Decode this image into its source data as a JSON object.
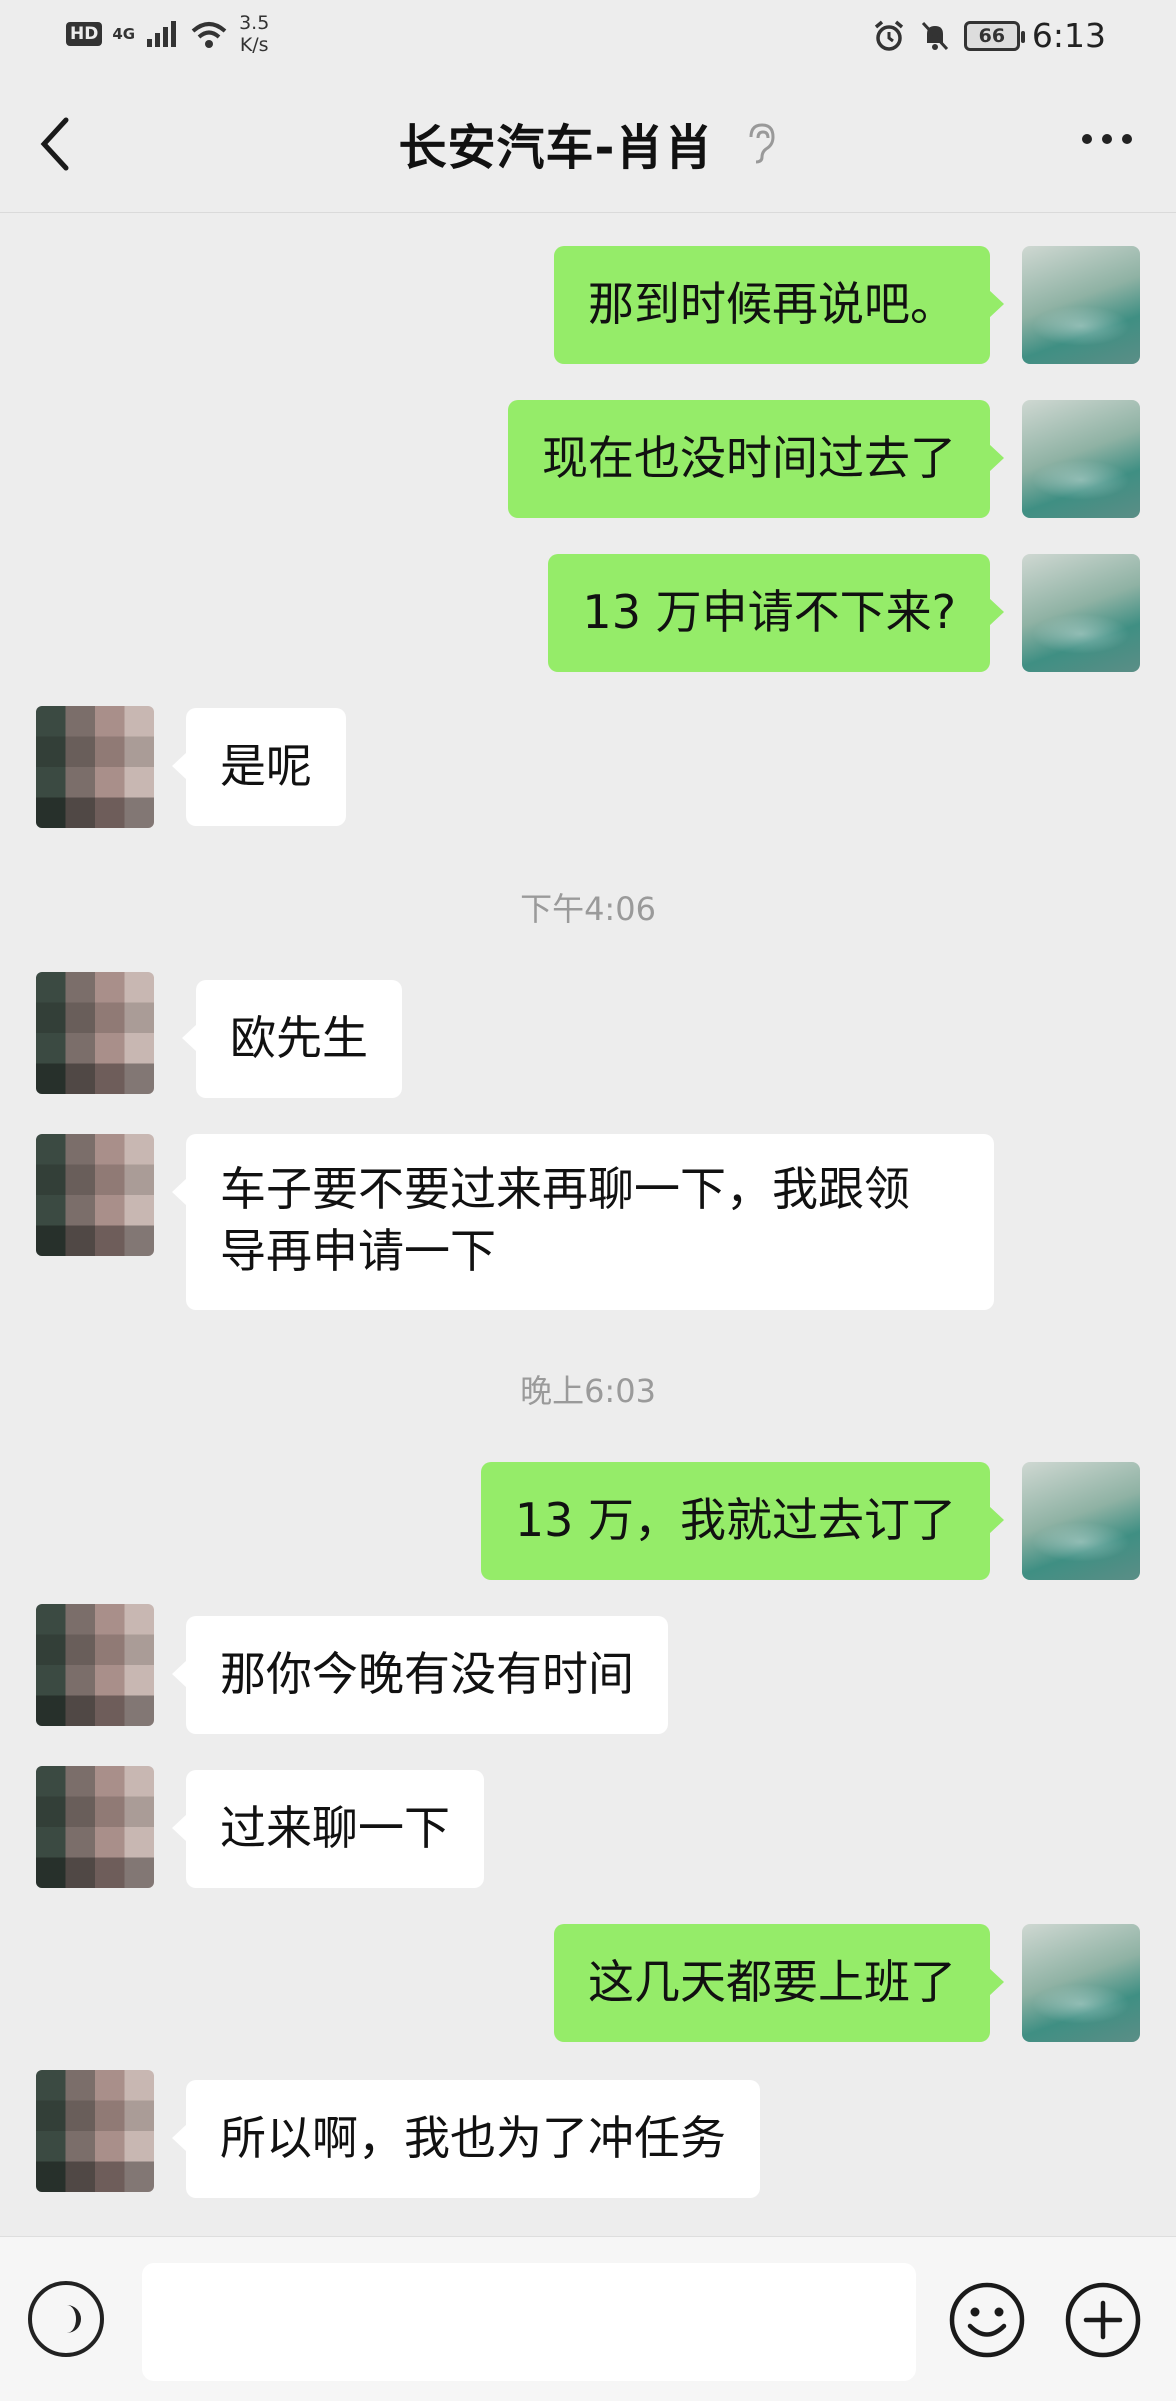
{
  "status_bar": {
    "hd": "HD",
    "network": "4G",
    "speed_value": "3.5",
    "speed_unit": "K/s",
    "battery": "66",
    "time": "6:13"
  },
  "header": {
    "title": "长安汽车-肖肖",
    "icons": [
      "back-arrow-icon",
      "ear-icon",
      "more-dots-icon"
    ]
  },
  "messages": [
    {
      "from": "me",
      "text": "那到时候再说吧。"
    },
    {
      "from": "me",
      "text": "现在也没时间过去了"
    },
    {
      "from": "me",
      "text": "13 万申请不下来?"
    },
    {
      "from": "other",
      "text": "是呢"
    },
    {
      "type": "time",
      "text": "下午4:06"
    },
    {
      "from": "other",
      "text": "欧先生"
    },
    {
      "from": "other",
      "line1": "车子要不要过来再聊一下，我跟领",
      "line2": "导再申请一下"
    },
    {
      "type": "time",
      "text": "晚上6:03"
    },
    {
      "from": "me",
      "text": "13 万，我就过去订了"
    },
    {
      "from": "other",
      "text": "那你今晚有没有时间"
    },
    {
      "from": "other",
      "text": "过来聊一下"
    },
    {
      "from": "me",
      "text": "这几天都要上班了"
    },
    {
      "from": "other",
      "text": "所以啊，我也为了冲任务"
    }
  ],
  "input_bar": {
    "value": "",
    "icons": [
      "voice-icon",
      "emoji-icon",
      "plus-icon"
    ]
  },
  "colors": {
    "background": "#ededed",
    "my_bubble": "#95ec69",
    "other_bubble": "#ffffff",
    "timestamp_text": "#9a9a9a"
  }
}
